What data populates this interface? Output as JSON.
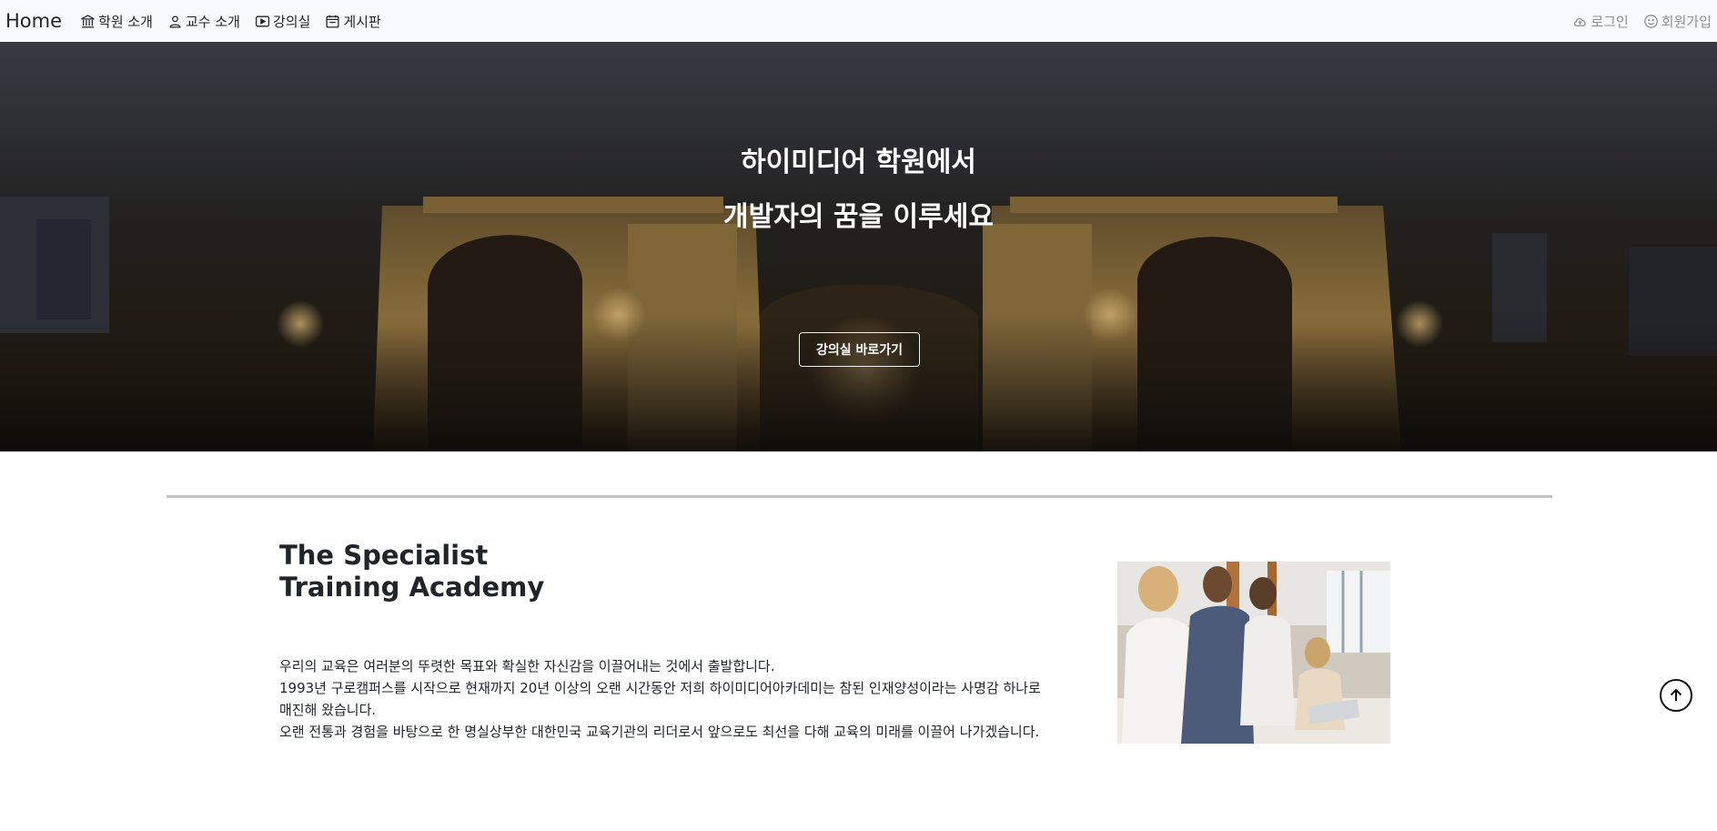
{
  "nav": {
    "brand": "Home",
    "items": [
      {
        "label": "학원 소개",
        "icon": "bank-icon"
      },
      {
        "label": "교수 소개",
        "icon": "person-icon"
      },
      {
        "label": "강의실",
        "icon": "play-icon"
      },
      {
        "label": "게시판",
        "icon": "calendar-icon"
      }
    ],
    "right": [
      {
        "label": "로그인",
        "icon": "cloud-upload-icon"
      },
      {
        "label": "회원가입",
        "icon": "smile-icon"
      }
    ]
  },
  "hero": {
    "line1": "하이미디어 학원에서",
    "line2": "개발자의 꿈을 이루세요",
    "button": "강의실 바로가기"
  },
  "about": {
    "title_line1": "The Specialist",
    "title_line2": "Training Academy",
    "paragraphs": [
      "우리의 교육은 여러분의 뚜렷한 목표와 확실한 자신감을 이끌어내는 것에서 출발합니다.",
      "1993년 구로캠퍼스를 시작으로 현재까지 20년 이상의 오랜 시간동안 저희 하이미디어아카데미는 참된 인재양성이라는 사명감 하나로 매진해 왔습니다.",
      "오랜 전통과 경험을 바탕으로 한 명실상부한 대한민국 교육기관의 리더로서 앞으로도 최선을 다해 교육의 미래를 이끌어 나가겠습니다."
    ]
  },
  "scroll_top": {
    "icon": "arrow-up-circle-icon"
  }
}
